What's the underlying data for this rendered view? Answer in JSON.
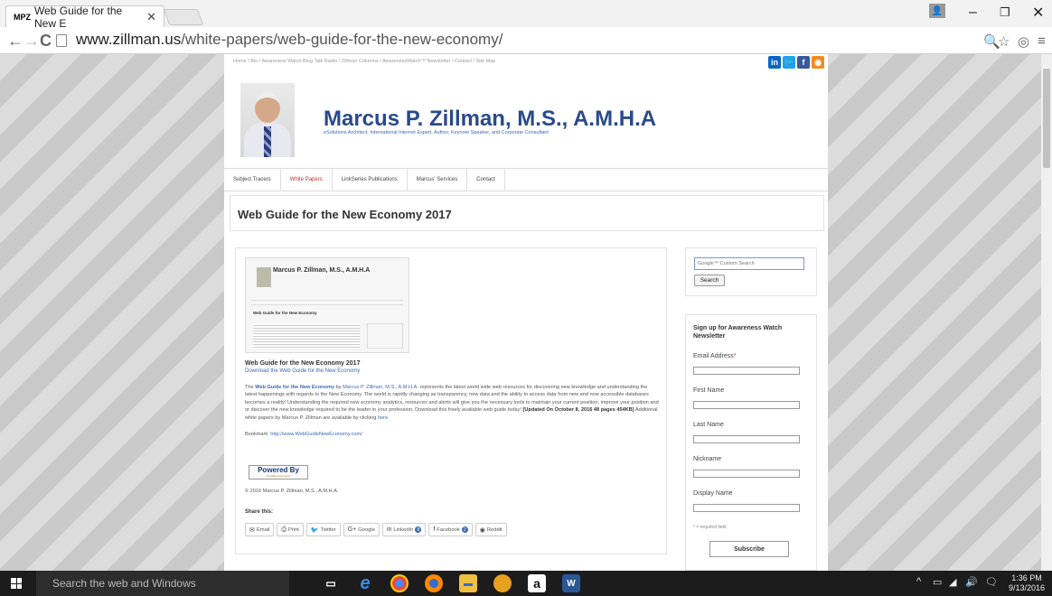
{
  "browser": {
    "tab_title": "Web Guide for the New E",
    "tab_favicon": "MPZ",
    "url_domain": "www.zillman.us",
    "url_path": "/white-papers/web-guide-for-the-new-economy/"
  },
  "site": {
    "breadcrumbs": "Home  /  Bio  /  Awareness Watch Blog Talk Radio  /  Zillman Columns  /  AwarenessWatch™ Newsletter  /  Contact  /  Site Map",
    "name": "Marcus P. Zillman, M.S., A.M.H.A",
    "tagline": "eSolutions Architect, International Internet Expert, Author, Keynote Speaker, and Corporate Consultant",
    "nav": [
      "Subject Tracers",
      "White Papers",
      "LinkSeries Publications",
      "Marcus' Services",
      "Contact"
    ],
    "active_nav": "White Papers"
  },
  "article": {
    "page_title": "Web Guide for the New Economy 2017",
    "thumb_name": "Marcus P. Zillman, M.S., A.M.H.A",
    "thumb_title": "Web Guide for the New Economy",
    "title": "Web Guide for the New Economy 2017",
    "download_link": "Download the Web Guide for the New Economy",
    "para_intro": "The ",
    "para_bold": "Web Guide for the New Economy",
    "para_by": " by ",
    "para_author": "Marcus P. Zillman, M.S., A.M.H.A.",
    "para_text": " represents the latest world wide web resources for discovering new knowledge and understanding the latest happenings with regards to the New Economy. The world is rapidly changing as transparency, new data and the ability to access data from new and now accessible databases becomes a reality! Understanding the required new economy analytics, resources and alerts will give you the necessary tools to maintain your current position, improve your position and or discover the new knowledge required to be the leader in your profession. Download this freely available web guide today! ",
    "para_updated": "[Updated On October 8, 2016  48 pages 454KB]",
    "para_more": " Additional white papers by Marcus P. Zillman are available by clicking ",
    "para_here": "here",
    "bookmark_label": "Bookmark: ",
    "bookmark_url": "http://www.WebGuideNewEconomy.com/",
    "powered_by": "Powered By",
    "powered_sub": "VirtualPrivateLibrary",
    "copyright": "© 2016 Marcus P. Zillman, M.S., A.M.H.A.",
    "share_label": "Share this:",
    "share_buttons": [
      {
        "label": "Email",
        "icon": "✉"
      },
      {
        "label": "Print",
        "icon": "⎙"
      },
      {
        "label": "Twitter",
        "icon": "🐦"
      },
      {
        "label": "Google",
        "icon": "G+"
      },
      {
        "label": "LinkedIn",
        "icon": "in",
        "count": "8"
      },
      {
        "label": "Facebook",
        "icon": "f",
        "count": "2"
      },
      {
        "label": "Reddit",
        "icon": "◉"
      }
    ]
  },
  "sidebar": {
    "search_placeholder": "Google™ Custom Search",
    "search_button": "Search",
    "newsletter_title": "Sign up for Awareness Watch Newsletter",
    "email_label": "Email Address",
    "first_name_label": "First Name",
    "last_name_label": "Last Name",
    "nickname_label": "Nickname",
    "display_name_label": "Display Name",
    "required_note": "* = required field",
    "subscribe_button": "Subscribe"
  },
  "taskbar": {
    "search_text": "Search the web and Windows",
    "time": "1:36 PM",
    "date": "9/13/2016"
  },
  "colors": {
    "accent_link": "#3a6ab0",
    "site_name": "#2a4a8a",
    "active_nav": "#c03030"
  }
}
